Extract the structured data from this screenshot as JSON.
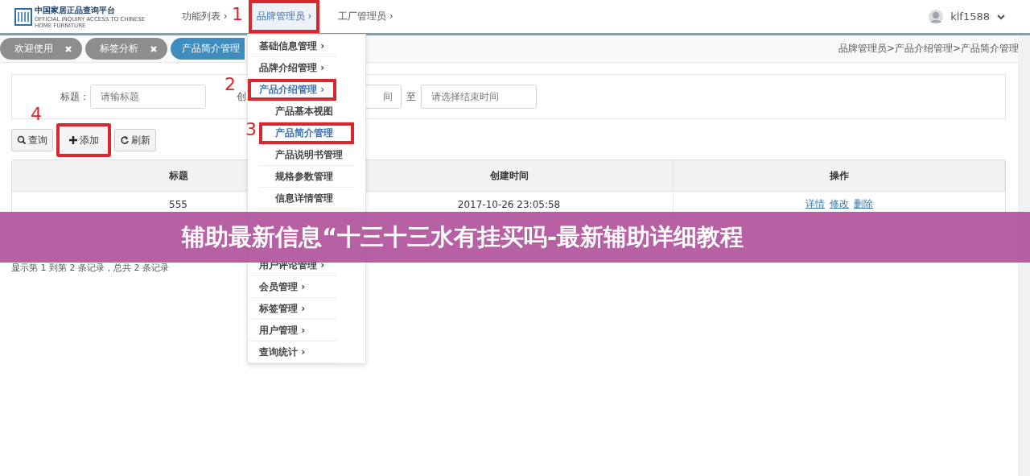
{
  "header": {
    "logo_text": "中国家居正品查询平台",
    "logo_subtext": "OFFICIAL INQUIRY ACCESS TO CHINESE HOME FURNITURE",
    "nav": [
      {
        "label": "功能列表 ›",
        "selected": false,
        "annotated": false
      },
      {
        "label": "品牌管理员 ›",
        "selected": true,
        "annotated": true
      },
      {
        "label": "工厂管理员 ›",
        "selected": false,
        "annotated": false
      }
    ],
    "user": "klf1588"
  },
  "tabs": [
    {
      "label": "欢迎使用",
      "selected": false
    },
    {
      "label": "标签分析",
      "selected": false
    },
    {
      "label": "产品简介管理",
      "selected": true
    }
  ],
  "breadcrumb": "品牌管理员>产品介绍管理>产品简介管理",
  "filter": {
    "title_label": "标题：",
    "title_placeholder": "请输标题",
    "date_label": "创",
    "start_placeholder": "间",
    "to_label": "至",
    "end_placeholder": "请选择结束时间"
  },
  "toolbar": [
    {
      "label": "查询",
      "kind": "search",
      "annotated": false
    },
    {
      "label": "添加",
      "kind": "plus",
      "annotated": true
    },
    {
      "label": "刷新",
      "kind": "refresh",
      "annotated": false
    }
  ],
  "table": {
    "columns": [
      "标题",
      "创建时间",
      "操作"
    ],
    "rows": [
      {
        "cells": [
          "555",
          "2017-10-26 23:05:58"
        ],
        "actions": [
          "详情",
          "修改",
          "删除"
        ]
      }
    ]
  },
  "pager": "显示第 1 到第 2 条记录，总共 2 条记录",
  "menu": {
    "items": [
      {
        "label": "基础信息管理 ›",
        "expanded": false,
        "annotated": false
      },
      {
        "label": "品牌介绍管理 ›",
        "expanded": false,
        "annotated": false
      },
      {
        "label": "产品介绍管理 ›",
        "expanded": true,
        "annotated": true,
        "children": [
          {
            "label": "产品基本视图",
            "selected": false,
            "annotated": false
          },
          {
            "label": "产品简介管理",
            "selected": true,
            "annotated": true
          },
          {
            "label": "产品说明书管理",
            "selected": false,
            "annotated": false
          },
          {
            "label": "规格参数管理",
            "selected": false,
            "annotated": false
          },
          {
            "label": "信息详情管理",
            "selected": false,
            "annotated": false
          }
        ]
      },
      {
        "label": "用户评论管理 ›",
        "expanded": false,
        "annotated": false
      },
      {
        "label": "会员管理 ›",
        "expanded": false,
        "annotated": false
      },
      {
        "label": "标签管理 ›",
        "expanded": false,
        "annotated": false
      },
      {
        "label": "用户管理 ›",
        "expanded": false,
        "annotated": false
      },
      {
        "label": "查询统计 ›",
        "expanded": false,
        "annotated": false
      }
    ]
  },
  "annotations": [
    "1",
    "2",
    "3",
    "4"
  ],
  "banner": "辅助最新信息“十三十三水有挂买吗-最新辅助详细教程"
}
